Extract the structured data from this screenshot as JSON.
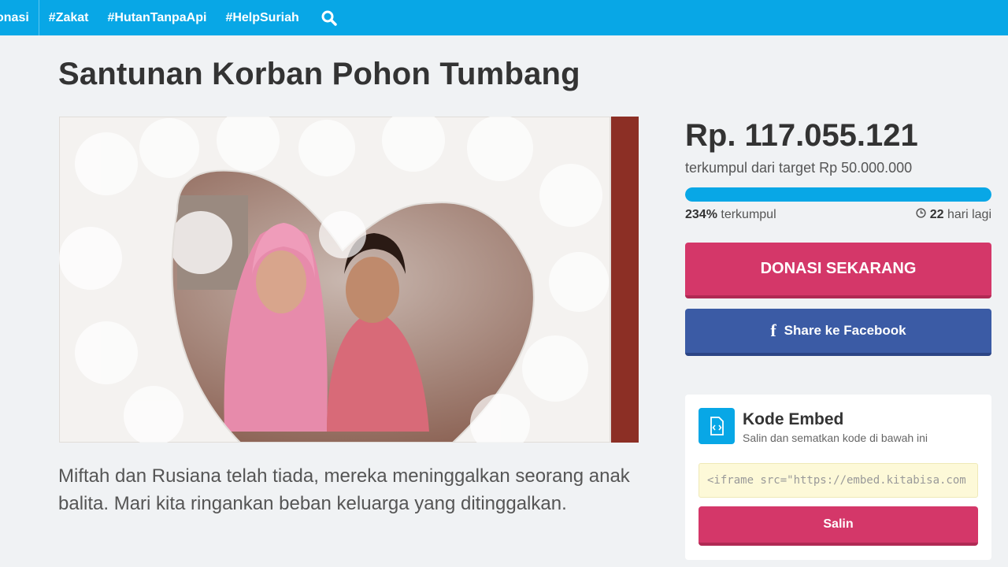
{
  "nav": {
    "items": [
      {
        "label": "onasi"
      },
      {
        "label": "#Zakat"
      },
      {
        "label": "#HutanTanpaApi"
      },
      {
        "label": "#HelpSuriah"
      }
    ],
    "search_icon": "search-icon"
  },
  "campaign": {
    "title": "Santunan Korban Pohon Tumbang",
    "description": "Miftah dan Rusiana telah tiada, mereka meninggalkan seorang anak balita. Mari kita ringankan beban keluarga yang ditinggalkan."
  },
  "funding": {
    "amount": "Rp. 117.055.121",
    "target_text": "terkumpul dari target Rp 50.000.000",
    "percent_value": "234%",
    "percent_label": " terkumpul",
    "progress_fill_fraction": 1.0,
    "days_value": "22",
    "days_label": " hari lagi"
  },
  "actions": {
    "donate_label": "DONASI SEKARANG",
    "facebook_label": "Share ke Facebook"
  },
  "embed": {
    "title": "Kode Embed",
    "subtitle": "Salin dan sematkan kode di bawah ini",
    "code_value": "<iframe src=\"https://embed.kitabisa.com",
    "copy_label": "Salin"
  },
  "colors": {
    "nav_bg": "#08a7e6",
    "donate": "#d43769",
    "facebook": "#3b5ba5",
    "embed_code_bg": "#fdf9d8"
  }
}
